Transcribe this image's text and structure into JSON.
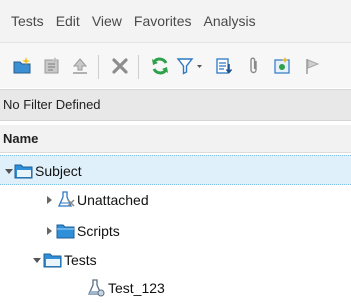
{
  "menu": {
    "items": [
      "Tests",
      "Edit",
      "View",
      "Favorites",
      "Analysis"
    ]
  },
  "toolbar": {
    "buttons": [
      {
        "icon": "new-folder-icon"
      },
      {
        "icon": "new-test-icon"
      },
      {
        "icon": "upload-icon"
      },
      {
        "icon": "delete-icon"
      },
      {
        "icon": "refresh-icon"
      },
      {
        "icon": "filter-icon"
      },
      {
        "icon": "details-icon"
      },
      {
        "icon": "attachment-icon"
      },
      {
        "icon": "script-icon"
      },
      {
        "icon": "flag-icon"
      }
    ],
    "colors": {
      "green": "#2fa14a",
      "blue": "#2f78c4",
      "gray": "#9a9a9a",
      "yellow": "#e8b935"
    }
  },
  "filter": {
    "text": "No Filter Defined"
  },
  "columns": {
    "name": "Name"
  },
  "tree": {
    "subject": {
      "label": "Subject",
      "expanded": true
    },
    "unattached": {
      "label": "Unattached",
      "expanded": false
    },
    "scripts": {
      "label": "Scripts",
      "expanded": false
    },
    "tests": {
      "label": "Tests",
      "expanded": true
    },
    "test_123": {
      "label": "Test_123"
    }
  },
  "colors": {
    "folder": "#2f8fd8",
    "selection": "#dff0fb"
  }
}
